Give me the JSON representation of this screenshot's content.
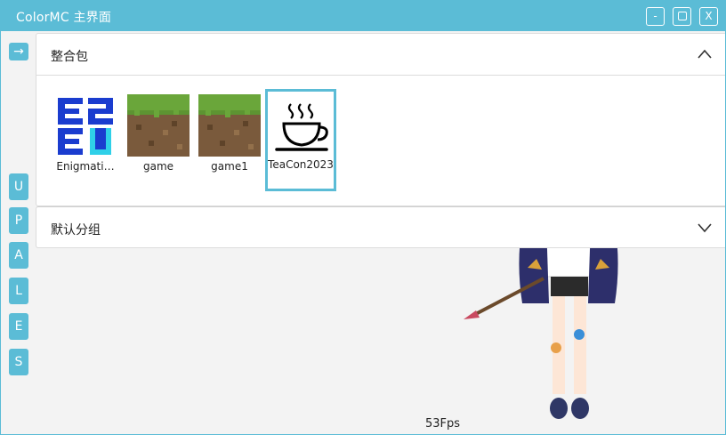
{
  "window": {
    "title": "ColorMC 主界面"
  },
  "window_controls": {
    "minimize": "-",
    "close": "X"
  },
  "rail": {
    "arrow": "→",
    "buttons": [
      "U",
      "P",
      "A",
      "L",
      "E",
      "S"
    ]
  },
  "groups": [
    {
      "title": "整合包",
      "expanded": true,
      "items": [
        {
          "name": "Enigmati…",
          "icon": "e2e-logo-icon",
          "selected": false
        },
        {
          "name": "game",
          "icon": "grass-block-icon",
          "selected": false
        },
        {
          "name": "game1",
          "icon": "grass-block-icon",
          "selected": false
        },
        {
          "name": "TeaCon2023",
          "icon": "teacup-icon",
          "selected": true
        }
      ]
    },
    {
      "title": "默认分组",
      "expanded": false,
      "items": []
    }
  ],
  "status": {
    "fps": "53Fps"
  },
  "colors": {
    "accent": "#5bbcd6",
    "selected_border": "#5bbcd6"
  }
}
